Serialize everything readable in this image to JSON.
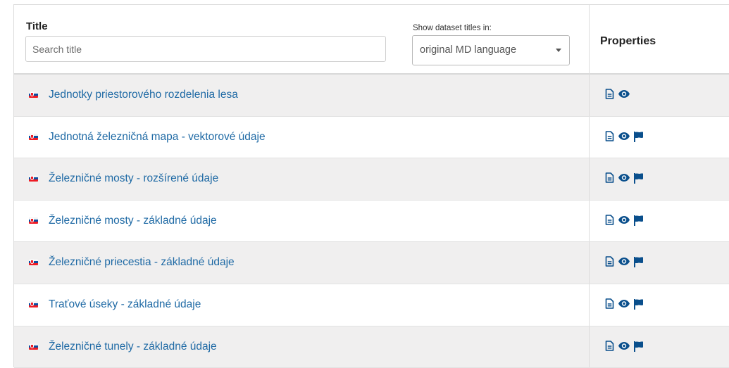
{
  "header": {
    "title_label": "Title",
    "search_placeholder": "Search title",
    "show_label": "Show dataset titles in:",
    "language_select": "original MD language",
    "properties_label": "Properties"
  },
  "rows": [
    {
      "title": "Jednotky priestorového rozdelenia lesa",
      "icons": [
        "document-icon",
        "eye-icon"
      ]
    },
    {
      "title": "Jednotná železničná mapa - vektorové údaje",
      "icons": [
        "document-icon",
        "eye-icon",
        "flag-icon"
      ]
    },
    {
      "title": "Železničné mosty - rozšírené údaje",
      "icons": [
        "document-icon",
        "eye-icon",
        "flag-icon"
      ]
    },
    {
      "title": "Železničné mosty - základné údaje",
      "icons": [
        "document-icon",
        "eye-icon",
        "flag-icon"
      ]
    },
    {
      "title": "Železničné priecestia - základné údaje",
      "icons": [
        "document-icon",
        "eye-icon",
        "flag-icon"
      ]
    },
    {
      "title": "Traťové úseky - základné údaje",
      "icons": [
        "document-icon",
        "eye-icon",
        "flag-icon"
      ]
    },
    {
      "title": "Železničné tunely - základné údaje",
      "icons": [
        "document-icon",
        "eye-icon",
        "flag-icon"
      ]
    }
  ],
  "colors": {
    "link": "#1f6aa5",
    "icon": "#0a4f8c",
    "row_alt": "#f0efef"
  }
}
